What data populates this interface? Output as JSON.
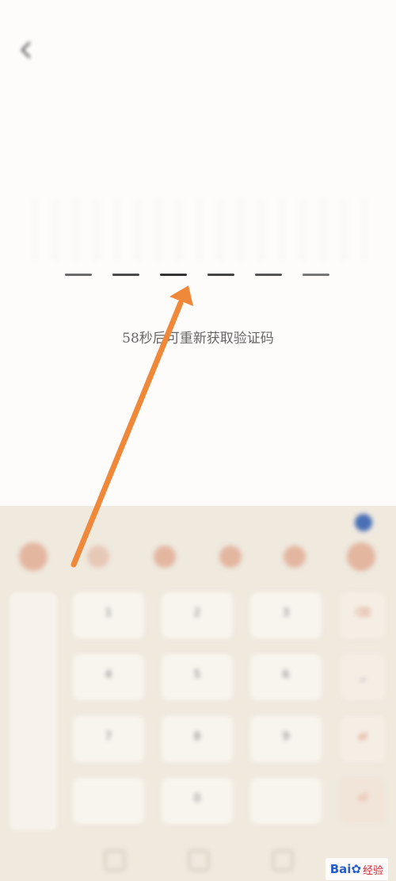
{
  "status_bar": {
    "left": "",
    "right": ""
  },
  "page": {
    "title": "",
    "subtitle_line1": "",
    "subtitle_line2": "",
    "code_slots": 6,
    "countdown": "58秒后可重新获取验证码"
  },
  "keyboard": {
    "keys": [
      "1",
      "2",
      "3",
      "4",
      "5",
      "6",
      "7",
      "8",
      "9",
      "",
      "0",
      ""
    ]
  },
  "watermark": {
    "brand": "Bai",
    "suffix": "经验"
  },
  "colors": {
    "arrow": "#f0883a",
    "keyboard_bg": "#efe9de",
    "accent_blue": "#2a5cc8"
  }
}
